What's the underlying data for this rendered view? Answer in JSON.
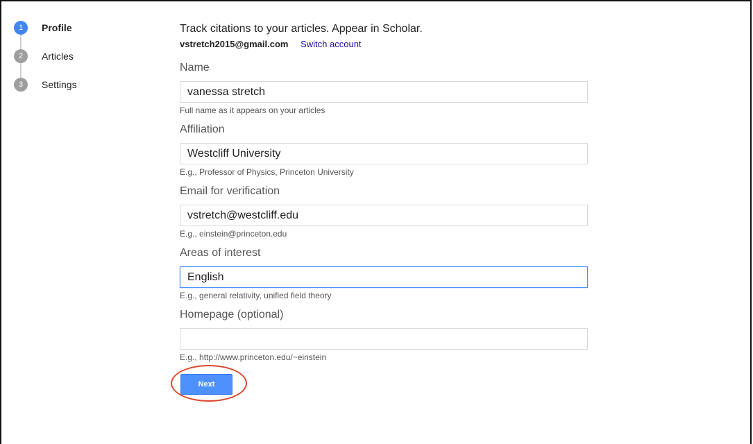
{
  "steps": [
    {
      "number": "1",
      "label": "Profile",
      "state": "active"
    },
    {
      "number": "2",
      "label": "Articles",
      "state": "inactive"
    },
    {
      "number": "3",
      "label": "Settings",
      "state": "inactive"
    }
  ],
  "header": {
    "headline": "Track citations to your articles. Appear in Scholar.",
    "account_email": "vstretch2015@gmail.com",
    "switch_account": "Switch account"
  },
  "fields": {
    "name": {
      "label": "Name",
      "value": "vanessa stretch",
      "hint": "Full name as it appears on your articles"
    },
    "affiliation": {
      "label": "Affiliation",
      "value": "Westcliff University",
      "hint": "E.g., Professor of Physics, Princeton University"
    },
    "email": {
      "label": "Email for verification",
      "value": "vstretch@westcliff.edu",
      "hint": "E.g., einstein@princeton.edu"
    },
    "interests": {
      "label": "Areas of interest",
      "value": "English",
      "hint": "E.g., general relativity, unified field theory"
    },
    "homepage": {
      "label": "Homepage (optional)",
      "value": "",
      "hint": "E.g., http://www.princeton.edu/~einstein"
    }
  },
  "actions": {
    "next_label": "Next"
  },
  "colors": {
    "accent": "#4285f4",
    "button": "#4d90fe",
    "link": "#1a0dab",
    "annotation": "#d9492f"
  }
}
